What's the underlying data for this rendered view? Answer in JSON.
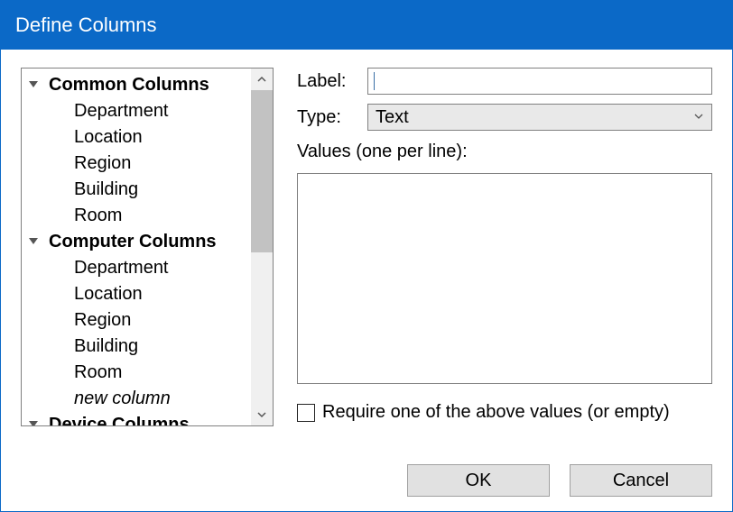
{
  "title": "Define Columns",
  "tree": {
    "groups": [
      {
        "header": "Common Columns",
        "items": [
          {
            "label": "Department",
            "italic": false
          },
          {
            "label": "Location",
            "italic": false
          },
          {
            "label": "Region",
            "italic": false
          },
          {
            "label": "Building",
            "italic": false
          },
          {
            "label": "Room",
            "italic": false
          }
        ]
      },
      {
        "header": "Computer Columns",
        "items": [
          {
            "label": "Department",
            "italic": false
          },
          {
            "label": "Location",
            "italic": false
          },
          {
            "label": "Region",
            "italic": false
          },
          {
            "label": "Building",
            "italic": false
          },
          {
            "label": "Room",
            "italic": false
          },
          {
            "label": "new column",
            "italic": true
          }
        ]
      },
      {
        "header": "Device Columns",
        "items": []
      }
    ]
  },
  "form": {
    "label_field_label": "Label:",
    "label_value": "",
    "type_field_label": "Type:",
    "type_value": "Text",
    "values_label": "Values (one per line):",
    "values_text": "",
    "require_checkbox_label": "Require one of the above values (or empty)",
    "require_checked": false
  },
  "buttons": {
    "ok": "OK",
    "cancel": "Cancel"
  }
}
